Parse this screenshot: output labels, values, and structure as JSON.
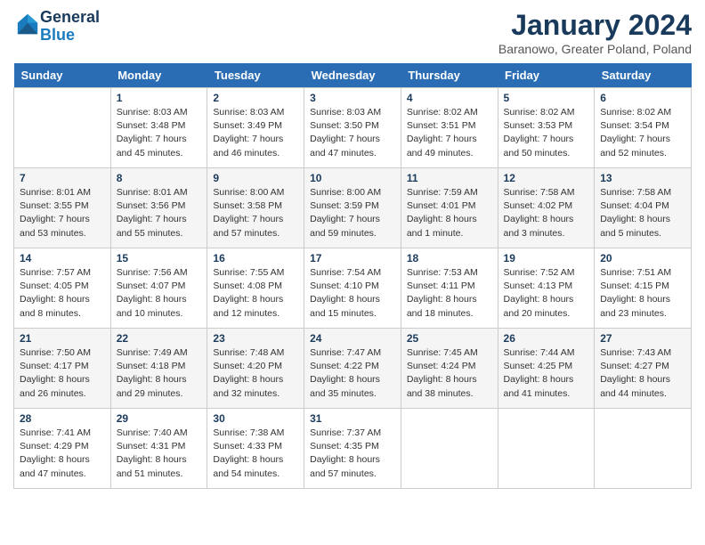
{
  "header": {
    "logo_line1": "General",
    "logo_line2": "Blue",
    "month_title": "January 2024",
    "subtitle": "Baranowo, Greater Poland, Poland"
  },
  "days_of_week": [
    "Sunday",
    "Monday",
    "Tuesday",
    "Wednesday",
    "Thursday",
    "Friday",
    "Saturday"
  ],
  "weeks": [
    [
      {
        "day": "",
        "info": ""
      },
      {
        "day": "1",
        "info": "Sunrise: 8:03 AM\nSunset: 3:48 PM\nDaylight: 7 hours\nand 45 minutes."
      },
      {
        "day": "2",
        "info": "Sunrise: 8:03 AM\nSunset: 3:49 PM\nDaylight: 7 hours\nand 46 minutes."
      },
      {
        "day": "3",
        "info": "Sunrise: 8:03 AM\nSunset: 3:50 PM\nDaylight: 7 hours\nand 47 minutes."
      },
      {
        "day": "4",
        "info": "Sunrise: 8:02 AM\nSunset: 3:51 PM\nDaylight: 7 hours\nand 49 minutes."
      },
      {
        "day": "5",
        "info": "Sunrise: 8:02 AM\nSunset: 3:53 PM\nDaylight: 7 hours\nand 50 minutes."
      },
      {
        "day": "6",
        "info": "Sunrise: 8:02 AM\nSunset: 3:54 PM\nDaylight: 7 hours\nand 52 minutes."
      }
    ],
    [
      {
        "day": "7",
        "info": "Sunrise: 8:01 AM\nSunset: 3:55 PM\nDaylight: 7 hours\nand 53 minutes."
      },
      {
        "day": "8",
        "info": "Sunrise: 8:01 AM\nSunset: 3:56 PM\nDaylight: 7 hours\nand 55 minutes."
      },
      {
        "day": "9",
        "info": "Sunrise: 8:00 AM\nSunset: 3:58 PM\nDaylight: 7 hours\nand 57 minutes."
      },
      {
        "day": "10",
        "info": "Sunrise: 8:00 AM\nSunset: 3:59 PM\nDaylight: 7 hours\nand 59 minutes."
      },
      {
        "day": "11",
        "info": "Sunrise: 7:59 AM\nSunset: 4:01 PM\nDaylight: 8 hours\nand 1 minute."
      },
      {
        "day": "12",
        "info": "Sunrise: 7:58 AM\nSunset: 4:02 PM\nDaylight: 8 hours\nand 3 minutes."
      },
      {
        "day": "13",
        "info": "Sunrise: 7:58 AM\nSunset: 4:04 PM\nDaylight: 8 hours\nand 5 minutes."
      }
    ],
    [
      {
        "day": "14",
        "info": "Sunrise: 7:57 AM\nSunset: 4:05 PM\nDaylight: 8 hours\nand 8 minutes."
      },
      {
        "day": "15",
        "info": "Sunrise: 7:56 AM\nSunset: 4:07 PM\nDaylight: 8 hours\nand 10 minutes."
      },
      {
        "day": "16",
        "info": "Sunrise: 7:55 AM\nSunset: 4:08 PM\nDaylight: 8 hours\nand 12 minutes."
      },
      {
        "day": "17",
        "info": "Sunrise: 7:54 AM\nSunset: 4:10 PM\nDaylight: 8 hours\nand 15 minutes."
      },
      {
        "day": "18",
        "info": "Sunrise: 7:53 AM\nSunset: 4:11 PM\nDaylight: 8 hours\nand 18 minutes."
      },
      {
        "day": "19",
        "info": "Sunrise: 7:52 AM\nSunset: 4:13 PM\nDaylight: 8 hours\nand 20 minutes."
      },
      {
        "day": "20",
        "info": "Sunrise: 7:51 AM\nSunset: 4:15 PM\nDaylight: 8 hours\nand 23 minutes."
      }
    ],
    [
      {
        "day": "21",
        "info": "Sunrise: 7:50 AM\nSunset: 4:17 PM\nDaylight: 8 hours\nand 26 minutes."
      },
      {
        "day": "22",
        "info": "Sunrise: 7:49 AM\nSunset: 4:18 PM\nDaylight: 8 hours\nand 29 minutes."
      },
      {
        "day": "23",
        "info": "Sunrise: 7:48 AM\nSunset: 4:20 PM\nDaylight: 8 hours\nand 32 minutes."
      },
      {
        "day": "24",
        "info": "Sunrise: 7:47 AM\nSunset: 4:22 PM\nDaylight: 8 hours\nand 35 minutes."
      },
      {
        "day": "25",
        "info": "Sunrise: 7:45 AM\nSunset: 4:24 PM\nDaylight: 8 hours\nand 38 minutes."
      },
      {
        "day": "26",
        "info": "Sunrise: 7:44 AM\nSunset: 4:25 PM\nDaylight: 8 hours\nand 41 minutes."
      },
      {
        "day": "27",
        "info": "Sunrise: 7:43 AM\nSunset: 4:27 PM\nDaylight: 8 hours\nand 44 minutes."
      }
    ],
    [
      {
        "day": "28",
        "info": "Sunrise: 7:41 AM\nSunset: 4:29 PM\nDaylight: 8 hours\nand 47 minutes."
      },
      {
        "day": "29",
        "info": "Sunrise: 7:40 AM\nSunset: 4:31 PM\nDaylight: 8 hours\nand 51 minutes."
      },
      {
        "day": "30",
        "info": "Sunrise: 7:38 AM\nSunset: 4:33 PM\nDaylight: 8 hours\nand 54 minutes."
      },
      {
        "day": "31",
        "info": "Sunrise: 7:37 AM\nSunset: 4:35 PM\nDaylight: 8 hours\nand 57 minutes."
      },
      {
        "day": "",
        "info": ""
      },
      {
        "day": "",
        "info": ""
      },
      {
        "day": "",
        "info": ""
      }
    ]
  ]
}
